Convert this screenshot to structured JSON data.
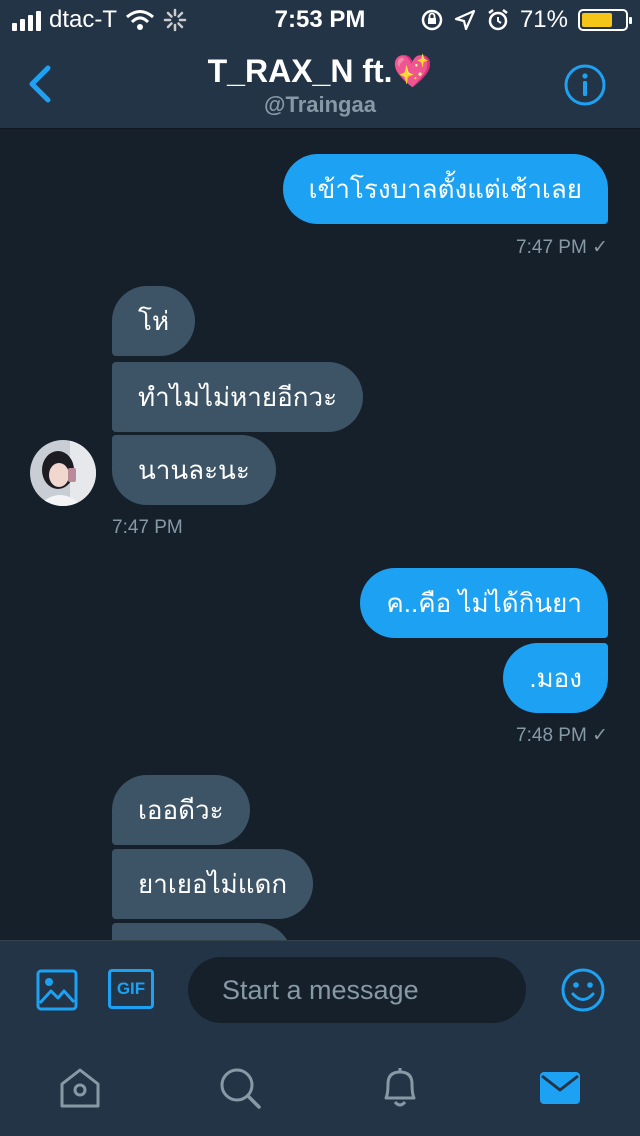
{
  "status_bar": {
    "carrier": "dtac-T",
    "time": "7:53 PM",
    "battery_percent_label": "71%",
    "battery_level": 0.71
  },
  "header": {
    "title": "T_RAX_N ft.💖",
    "handle": "@Traingaa"
  },
  "messages": {
    "m1": "เข้าโรงบาลตั้งแต่เช้าเลย",
    "t1": "7:47 PM ✓",
    "m2": "โห่",
    "m3": "ทำไมไม่หายอีกวะ",
    "m4": "นานละนะ",
    "t2": "7:47 PM",
    "m5": "ค..คือ ไม่ได้กินยา",
    "m6": ".มอง",
    "t3": "7:48 PM ✓",
    "m7": "เออดีวะ",
    "m8": "ยาเยอไม่แดก"
  },
  "composer": {
    "placeholder": "Start a message",
    "gif_label": "GIF"
  },
  "colors": {
    "accent": "#1da1f2",
    "background": "#15202b",
    "bar": "#243447",
    "incoming_bubble": "#3d5466",
    "muted": "#8899a6",
    "battery": "#f5c518"
  },
  "icons": [
    "signal-icon",
    "wifi-icon",
    "loading-icon",
    "rotation-lock-icon",
    "location-icon",
    "alarm-icon",
    "battery-icon",
    "back-arrow-icon",
    "info-icon",
    "image-icon",
    "gif-icon",
    "emoji-icon",
    "home-icon",
    "search-icon",
    "notifications-icon",
    "messages-icon"
  ]
}
